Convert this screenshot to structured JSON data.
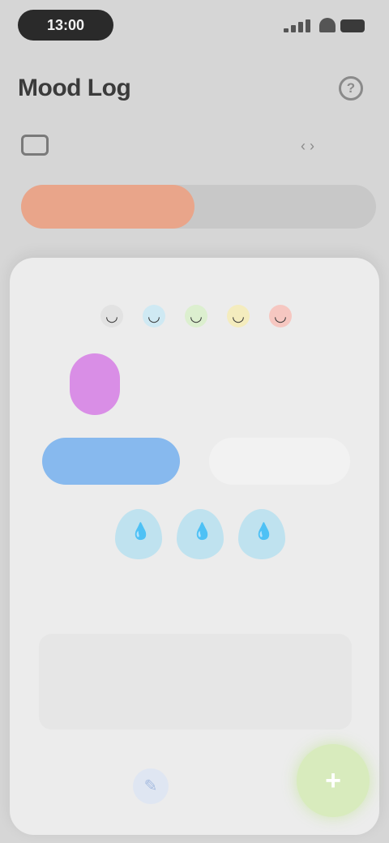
{
  "status_bar": {
    "time": "13:00",
    "icons": [
      "signal-icon",
      "wifi-icon",
      "battery-icon"
    ]
  },
  "header": {
    "title": "Mood Log",
    "help_icon": "?"
  },
  "date_row": {
    "icon": "calendar-icon",
    "label": "",
    "nav": "‹ ›"
  },
  "segment": {
    "active_label": "",
    "inactive_label": ""
  },
  "legend": [
    "",
    "",
    ""
  ],
  "sheet": {
    "emoji_faces": [
      {
        "face": "◡",
        "color": "#e2e2e2"
      },
      {
        "face": "◡",
        "color": "#cfe9f3"
      },
      {
        "face": "◡",
        "color": "#dcefcf"
      },
      {
        "face": "◡",
        "color": "#f4ecbe"
      },
      {
        "face": "◡",
        "color": "#f6c7c1"
      }
    ],
    "mood_days": [
      "",
      "",
      "",
      "",
      "",
      "",
      ""
    ],
    "selected_day": "",
    "primary_button": "",
    "secondary_button": "",
    "water_drops": 3,
    "section_title": "",
    "note_placeholder": "",
    "fab_icon": "+",
    "edit_icon": "✎"
  },
  "colors": {
    "accent_orange": "#e9a58a",
    "selected_purple": "#d98ee6",
    "primary_blue": "#87b9ee",
    "water_blue": "#bfe2ef",
    "fab_green": "#d8ebbd"
  }
}
